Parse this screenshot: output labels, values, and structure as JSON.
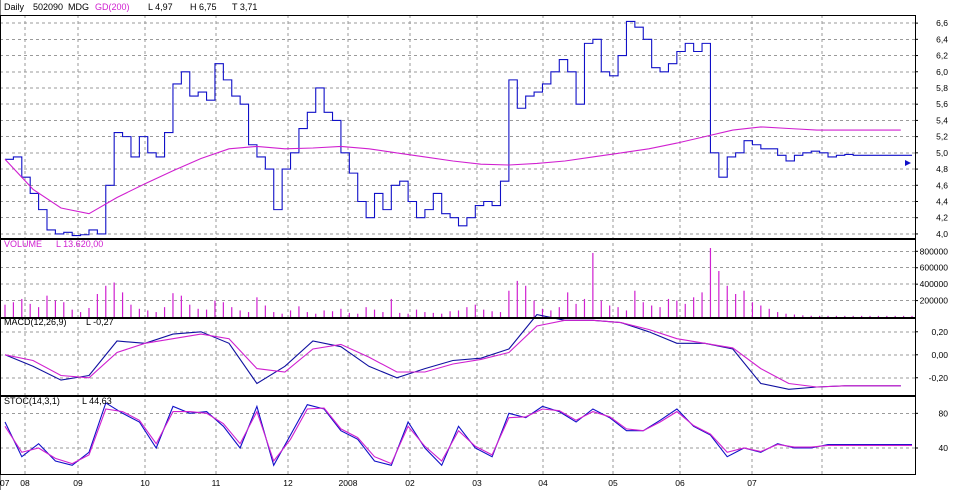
{
  "header": {
    "period": "Daily",
    "symbol": "502090",
    "name": "MDG",
    "ma_label": "GD(200)",
    "low": "L 4,97",
    "high": "H 6,75",
    "t": "T 3,71"
  },
  "volume_panel": {
    "label": "VOLUME",
    "value": "L  13.620,00"
  },
  "macd_panel": {
    "label": "MACD(12,26,9)",
    "value": "L  -0,27"
  },
  "stoc_panel": {
    "label": "STOC(14,3,1)",
    "value": "L  44,63"
  },
  "colors": {
    "price": "#1010c8",
    "ma": "#d020d0",
    "volume": "#d020d0",
    "macd": "#1010a0",
    "signal": "#d020d0",
    "stoch_k": "#1010c8",
    "stoch_d": "#d020d0",
    "grid": "#9a9a9a"
  },
  "x_axis": {
    "labels": [
      "07",
      "08",
      "09",
      "10",
      "11",
      "12",
      "2008",
      "02",
      "03",
      "04",
      "05",
      "06",
      "07"
    ]
  },
  "chart_data": [
    {
      "type": "line",
      "title": "",
      "ylim": [
        3.95,
        6.7
      ],
      "y_ticks": [
        "6,6",
        "6,4",
        "6,2",
        "6,0",
        "5,8",
        "5,6",
        "5,4",
        "5,2",
        "5,0",
        "4,8",
        "4,6",
        "4,4",
        "4,2",
        "4,0"
      ],
      "y_tick_values": [
        6.6,
        6.4,
        6.2,
        6.0,
        5.8,
        5.6,
        5.4,
        5.2,
        5.0,
        4.8,
        4.6,
        4.4,
        4.2,
        4.0
      ],
      "series": [
        {
          "name": "",
          "role": "price",
          "x": [
            0,
            3,
            6,
            9,
            12,
            15,
            18,
            21,
            24,
            27,
            30,
            33,
            36,
            39,
            42,
            45,
            48,
            51,
            54,
            57,
            60,
            63,
            66,
            69,
            72,
            75,
            78,
            81,
            84,
            87,
            90,
            93,
            96,
            99,
            102,
            105,
            108,
            111,
            114,
            117,
            120,
            123,
            126,
            129,
            132,
            135,
            138,
            141,
            144,
            147,
            150,
            153,
            156,
            159,
            162,
            165,
            168,
            171,
            174,
            177,
            180,
            183,
            186,
            189,
            192,
            195,
            198,
            201,
            204,
            207,
            210,
            213,
            216,
            219,
            222,
            225,
            228,
            231,
            234,
            237,
            240,
            243,
            246,
            249,
            252,
            255,
            258,
            261,
            264,
            267,
            270,
            273,
            276,
            279,
            282,
            285,
            288,
            291,
            294,
            297,
            300,
            303,
            306,
            309,
            312,
            315,
            318,
            321,
            324
          ],
          "values": [
            4.92,
            4.95,
            4.7,
            4.5,
            4.3,
            4.05,
            4.0,
            4.02,
            3.98,
            3.99,
            4.05,
            4.0,
            4.6,
            5.25,
            5.2,
            4.95,
            5.2,
            5.0,
            4.95,
            5.25,
            5.85,
            6.0,
            5.7,
            5.75,
            5.65,
            6.1,
            5.9,
            5.7,
            5.6,
            5.1,
            4.95,
            4.8,
            4.3,
            4.8,
            5.0,
            5.3,
            5.5,
            5.8,
            5.5,
            5.4,
            5.0,
            4.75,
            4.4,
            4.2,
            4.5,
            4.3,
            4.6,
            4.65,
            4.4,
            4.2,
            4.3,
            4.5,
            4.25,
            4.2,
            4.1,
            4.2,
            4.35,
            4.4,
            4.35,
            4.65,
            5.9,
            5.55,
            5.7,
            5.75,
            5.85,
            6.0,
            6.15,
            6.0,
            5.6,
            6.35,
            6.4,
            6.0,
            5.95,
            6.2,
            6.62,
            6.55,
            6.4,
            6.05,
            6.0,
            6.1,
            6.25,
            6.35,
            6.25,
            6.35,
            5.0,
            4.7,
            4.95,
            5.0,
            5.15,
            5.1,
            5.05,
            5.05,
            4.97,
            4.9,
            4.97,
            5.0,
            5.02,
            5.0,
            4.95,
            4.97,
            4.98,
            4.97,
            4.97,
            4.97,
            4.97,
            4.97,
            4.97,
            4.97,
            4.97
          ]
        },
        {
          "name": "GD(200)",
          "role": "ma",
          "x": [
            0,
            10,
            20,
            30,
            40,
            50,
            60,
            70,
            80,
            90,
            100,
            110,
            120,
            130,
            140,
            150,
            160,
            170,
            180,
            190,
            200,
            210,
            220,
            230,
            240,
            250,
            260,
            270,
            280,
            290,
            300,
            310,
            320
          ],
          "values": [
            4.92,
            4.55,
            4.32,
            4.25,
            4.45,
            4.62,
            4.78,
            4.93,
            5.05,
            5.08,
            5.05,
            5.06,
            5.08,
            5.05,
            5.0,
            4.95,
            4.9,
            4.86,
            4.85,
            4.87,
            4.9,
            4.95,
            5.0,
            5.05,
            5.12,
            5.2,
            5.28,
            5.32,
            5.3,
            5.28,
            5.28,
            5.28,
            5.28
          ]
        }
      ]
    },
    {
      "type": "bar",
      "title": "",
      "ylim": [
        0,
        950000
      ],
      "y_ticks": [
        "800000",
        "600000",
        "400000",
        "200000"
      ],
      "y_tick_values": [
        800000,
        600000,
        400000,
        200000
      ],
      "x": [
        0,
        3,
        6,
        9,
        12,
        15,
        18,
        21,
        24,
        27,
        30,
        33,
        36,
        39,
        42,
        45,
        48,
        51,
        54,
        57,
        60,
        63,
        66,
        69,
        72,
        75,
        78,
        81,
        84,
        87,
        90,
        93,
        96,
        99,
        102,
        105,
        108,
        111,
        114,
        117,
        120,
        123,
        126,
        129,
        132,
        135,
        138,
        141,
        144,
        147,
        150,
        153,
        156,
        159,
        162,
        165,
        168,
        171,
        174,
        177,
        180,
        183,
        186,
        189,
        192,
        195,
        198,
        201,
        204,
        207,
        210,
        213,
        216,
        219,
        222,
        225,
        228,
        231,
        234,
        237,
        240,
        243,
        246,
        249,
        252,
        255,
        258,
        261,
        264,
        267,
        270,
        273,
        276,
        279,
        282,
        285,
        288,
        291,
        294,
        297,
        300,
        303,
        306,
        309,
        312,
        315,
        318,
        321,
        324
      ],
      "values": [
        150000,
        180000,
        220000,
        160000,
        120000,
        260000,
        200000,
        180000,
        90000,
        60000,
        110000,
        280000,
        380000,
        420000,
        300000,
        150000,
        100000,
        80000,
        60000,
        120000,
        290000,
        260000,
        150000,
        100000,
        90000,
        200000,
        180000,
        120000,
        80000,
        60000,
        240000,
        140000,
        60000,
        40000,
        80000,
        130000,
        60000,
        40000,
        80000,
        70000,
        100000,
        50000,
        40000,
        120000,
        90000,
        60000,
        220000,
        50000,
        40000,
        90000,
        60000,
        50000,
        40000,
        70000,
        80000,
        120000,
        150000,
        90000,
        70000,
        60000,
        320000,
        440000,
        380000,
        200000,
        100000,
        80000,
        120000,
        300000,
        160000,
        220000,
        780000,
        200000,
        140000,
        120000,
        80000,
        320000,
        180000,
        140000,
        120000,
        220000,
        200000,
        160000,
        240000,
        300000,
        840000,
        560000,
        380000,
        280000,
        320000,
        180000,
        140000,
        100000,
        60000,
        40000,
        30000,
        20000,
        15000,
        14000,
        14000,
        14000,
        13620,
        13620,
        13620,
        13620,
        13620,
        13620,
        13620,
        13620,
        13620
      ],
      "series": [
        {
          "name": "VOLUME"
        }
      ]
    },
    {
      "type": "line",
      "title": "",
      "ylim": [
        -0.35,
        0.32
      ],
      "y_ticks": [
        "0,20",
        "0,00",
        "-0,20"
      ],
      "y_tick_values": [
        0.2,
        0.0,
        -0.2
      ],
      "series": [
        {
          "name": "",
          "role": "macd",
          "x": [
            0,
            10,
            20,
            30,
            40,
            50,
            60,
            70,
            80,
            90,
            100,
            110,
            120,
            130,
            140,
            150,
            160,
            170,
            180,
            190,
            200,
            210,
            220,
            230,
            240,
            250,
            260,
            270,
            280,
            290,
            300,
            310,
            320
          ],
          "values": [
            0.0,
            -0.1,
            -0.22,
            -0.18,
            0.12,
            0.1,
            0.18,
            0.2,
            0.1,
            -0.25,
            -0.1,
            0.12,
            0.07,
            -0.1,
            -0.2,
            -0.12,
            -0.05,
            -0.03,
            0.05,
            0.35,
            0.3,
            0.3,
            0.28,
            0.2,
            0.1,
            0.1,
            0.05,
            -0.25,
            -0.3,
            -0.28,
            -0.27,
            -0.27,
            -0.27
          ]
        },
        {
          "name": "",
          "role": "signal",
          "x": [
            0,
            10,
            20,
            30,
            40,
            50,
            60,
            70,
            80,
            90,
            100,
            110,
            120,
            130,
            140,
            150,
            160,
            170,
            180,
            190,
            200,
            210,
            220,
            230,
            240,
            250,
            260,
            270,
            280,
            290,
            300,
            310,
            320
          ],
          "values": [
            0.0,
            -0.05,
            -0.18,
            -0.2,
            0.02,
            0.1,
            0.14,
            0.18,
            0.14,
            -0.12,
            -0.15,
            0.05,
            0.09,
            -0.02,
            -0.15,
            -0.15,
            -0.08,
            -0.04,
            0.02,
            0.25,
            0.3,
            0.3,
            0.28,
            0.22,
            0.14,
            0.1,
            0.06,
            -0.12,
            -0.25,
            -0.28,
            -0.27,
            -0.27,
            -0.27
          ]
        }
      ]
    },
    {
      "type": "line",
      "title": "",
      "ylim": [
        10,
        100
      ],
      "y_ticks": [
        "80",
        "40"
      ],
      "y_tick_values": [
        80,
        40
      ],
      "series": [
        {
          "name": "",
          "role": "k",
          "x": [
            0,
            6,
            12,
            18,
            24,
            30,
            36,
            42,
            48,
            54,
            60,
            66,
            72,
            78,
            84,
            90,
            96,
            102,
            108,
            114,
            120,
            126,
            132,
            138,
            144,
            150,
            156,
            162,
            168,
            174,
            180,
            186,
            192,
            198,
            204,
            210,
            216,
            222,
            228,
            234,
            240,
            246,
            252,
            258,
            264,
            270,
            276,
            282,
            288,
            294,
            300,
            306,
            312,
            318,
            324
          ],
          "values": [
            70,
            30,
            45,
            25,
            20,
            35,
            92,
            80,
            70,
            40,
            88,
            80,
            82,
            65,
            40,
            88,
            20,
            55,
            90,
            85,
            60,
            50,
            25,
            20,
            70,
            40,
            20,
            65,
            40,
            30,
            80,
            75,
            88,
            82,
            70,
            85,
            75,
            60,
            60,
            72,
            85,
            65,
            55,
            30,
            40,
            35,
            45,
            40,
            40,
            44,
            44,
            44,
            44,
            44,
            44
          ]
        },
        {
          "name": "",
          "role": "d",
          "x": [
            0,
            6,
            12,
            18,
            24,
            30,
            36,
            42,
            48,
            54,
            60,
            66,
            72,
            78,
            84,
            90,
            96,
            102,
            108,
            114,
            120,
            126,
            132,
            138,
            144,
            150,
            156,
            162,
            168,
            174,
            180,
            186,
            192,
            198,
            204,
            210,
            216,
            222,
            228,
            234,
            240,
            246,
            252,
            258,
            264,
            270,
            276,
            282,
            288,
            294,
            300,
            306,
            312,
            318,
            324
          ],
          "values": [
            65,
            35,
            40,
            28,
            22,
            32,
            85,
            82,
            72,
            45,
            82,
            82,
            80,
            68,
            45,
            82,
            25,
            50,
            85,
            86,
            62,
            52,
            30,
            22,
            65,
            42,
            25,
            60,
            42,
            32,
            75,
            76,
            85,
            83,
            72,
            82,
            76,
            62,
            60,
            70,
            82,
            66,
            56,
            35,
            40,
            36,
            44,
            41,
            41,
            43,
            43,
            43,
            43,
            43,
            43
          ]
        }
      ]
    }
  ]
}
